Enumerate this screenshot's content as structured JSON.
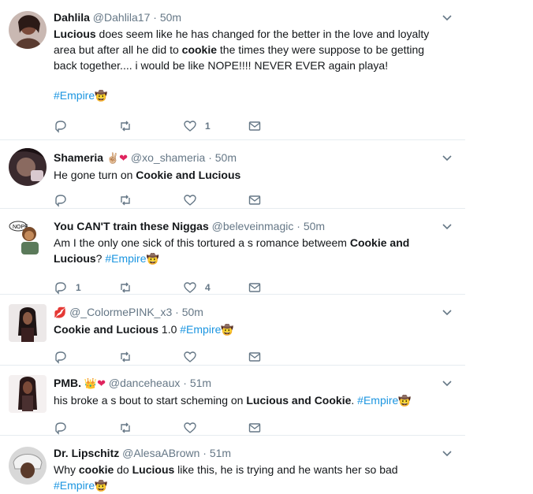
{
  "tweets": [
    {
      "name": "Dahlila",
      "handle": "@Dahlila17",
      "dot": "·",
      "time": "50m",
      "text_parts": [
        "",
        "Lucious",
        " does seem like he has changed for the better in the love and loyalty area but after all he did to ",
        "cookie",
        " the times they were suppose to be getting back together.... i would be like NOPE!!!! NEVER EVER again playa!"
      ],
      "hashtag": "#Empire",
      "reply_count": "",
      "like_count": "1"
    },
    {
      "name": "Shameria",
      "handle": "@xo_shameria",
      "dot": "·",
      "time": "50m",
      "text_plain": "He gone turn on ",
      "text_bold": "Cookie and Lucious",
      "reply_count": "",
      "like_count": ""
    },
    {
      "name": "You CAN'T train these Niggas",
      "handle": "@beleveinmagic",
      "dot": "·",
      "time": "50m",
      "text_plain": "Am I the only one sick of this tortured a  s romance betweem ",
      "text_bold": "Cookie and Lucious",
      "text_after": "? ",
      "hashtag": "#Empire",
      "reply_count": "1",
      "like_count": "4"
    },
    {
      "name": "",
      "handle": "@_ColormePINK_x3",
      "dot": "·",
      "time": "50m",
      "text_bold": "Cookie and Lucious",
      "text_after": " 1.0 ",
      "hashtag": "#Empire",
      "reply_count": "",
      "like_count": ""
    },
    {
      "name": "PMB.",
      "handle": "@danceheaux",
      "dot": "·",
      "time": "51m",
      "text_plain": "his broke a  s bout to start scheming on ",
      "text_bold": "Lucious and Cookie",
      "text_after": ". ",
      "hashtag": "#Empire",
      "reply_count": "",
      "like_count": ""
    },
    {
      "name": "Dr. Lipschitz",
      "handle": "@AlesaABrown",
      "dot": "·",
      "time": "51m",
      "text_parts": [
        "Why ",
        "cookie",
        " do ",
        "Lucious",
        " like this, he is trying and he wants her so bad "
      ],
      "hashtag": "#Empire"
    }
  ],
  "icons": {
    "reply": "reply-icon",
    "retweet": "retweet-icon",
    "like": "heart-icon",
    "dm": "envelope-icon",
    "caret": "chevron-down-icon"
  },
  "colors": {
    "link": "#1b95e0",
    "muted": "#657786",
    "heart": "#e0245e"
  }
}
